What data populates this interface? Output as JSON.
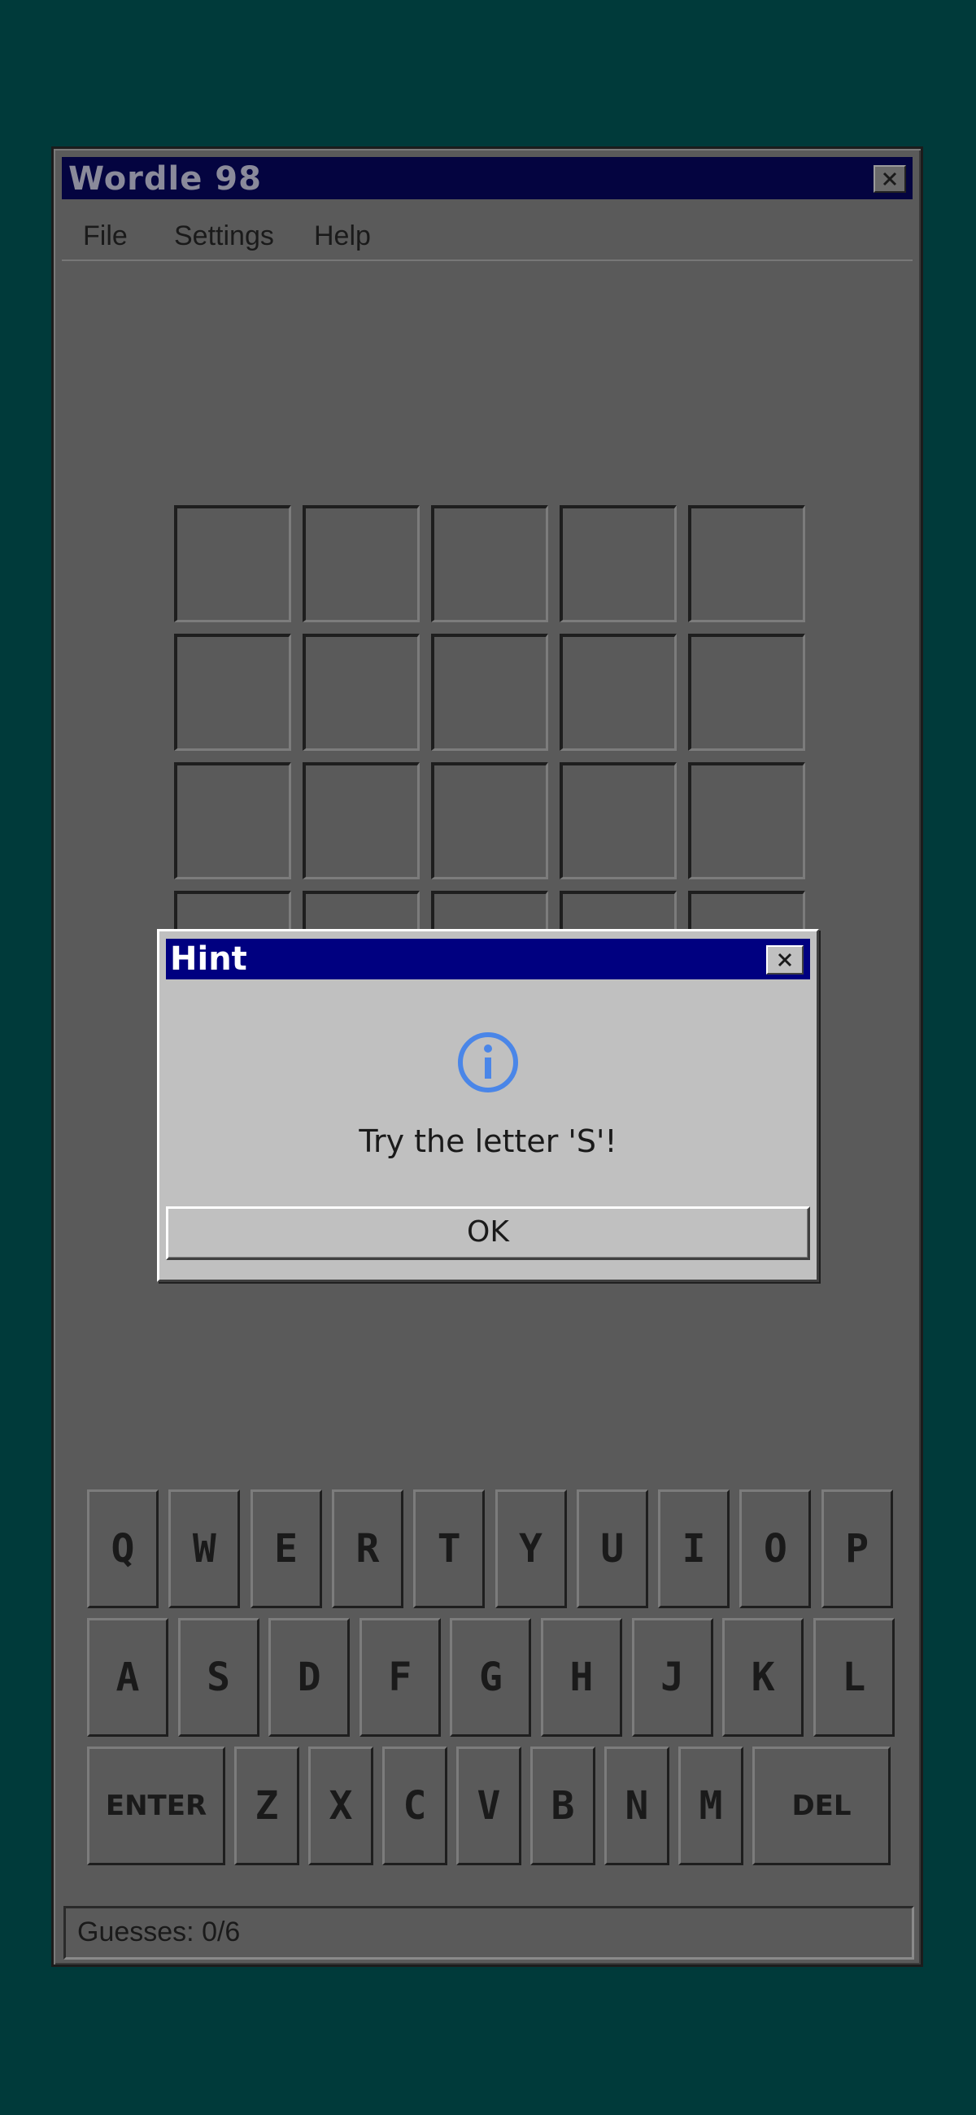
{
  "window": {
    "title": "Wordle 98"
  },
  "menu": {
    "items": [
      "File",
      "Settings",
      "Help"
    ]
  },
  "board": {
    "rows": 6,
    "cols": 5
  },
  "dialog": {
    "title": "Hint",
    "message": "Try the letter 'S'!",
    "ok_label": "OK"
  },
  "keyboard": {
    "row1": [
      "Q",
      "W",
      "E",
      "R",
      "T",
      "Y",
      "U",
      "I",
      "O",
      "P"
    ],
    "row2": [
      "A",
      "S",
      "D",
      "F",
      "G",
      "H",
      "J",
      "K",
      "L"
    ],
    "row3": [
      "ENTER",
      "Z",
      "X",
      "C",
      "V",
      "B",
      "N",
      "M",
      "DEL"
    ]
  },
  "status": {
    "text": "Guesses: 0/6"
  },
  "colors": {
    "desktop": "#003a3a",
    "window": "#5a5a5a",
    "dialog_title": "#000080",
    "info_icon": "#4a86e8"
  }
}
